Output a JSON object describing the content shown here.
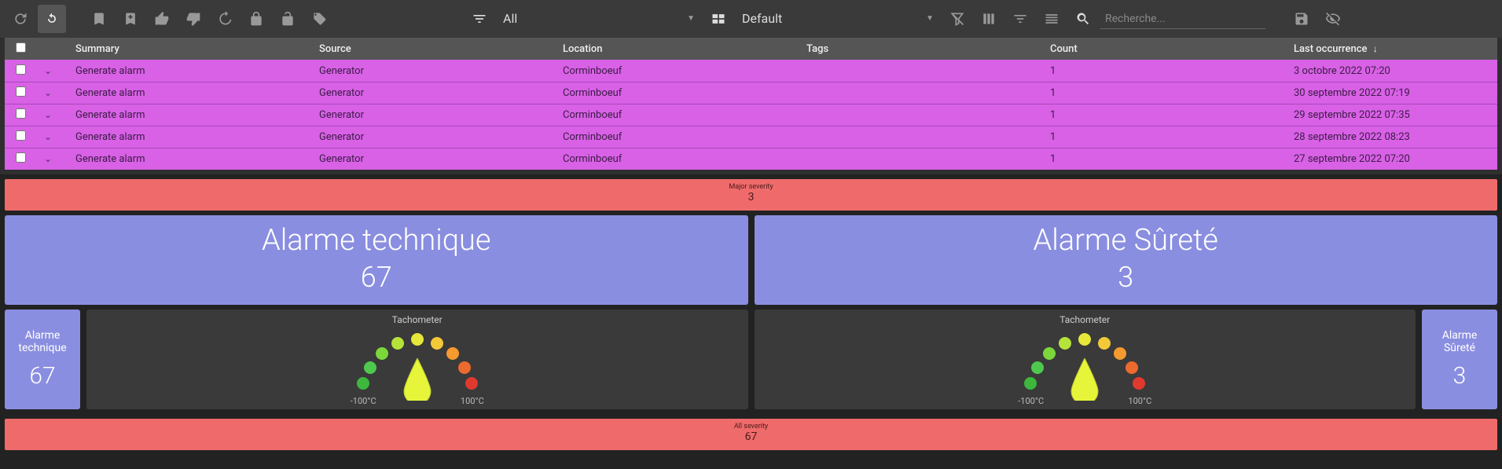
{
  "toolbar": {
    "filter_label": "All",
    "view_label": "Default",
    "search_placeholder": "Recherche..."
  },
  "columns": {
    "summary": "Summary",
    "source": "Source",
    "location": "Location",
    "tags": "Tags",
    "count": "Count",
    "last": "Last occurrence"
  },
  "rows": [
    {
      "summary": "Generate alarm",
      "source": "Generator",
      "location": "Corminboeuf",
      "tags": "",
      "count": "1",
      "last": "3 octobre 2022 07:20"
    },
    {
      "summary": "Generate alarm",
      "source": "Generator",
      "location": "Corminboeuf",
      "tags": "",
      "count": "1",
      "last": "30 septembre 2022 07:19"
    },
    {
      "summary": "Generate alarm",
      "source": "Generator",
      "location": "Corminboeuf",
      "tags": "",
      "count": "1",
      "last": "29 septembre 2022 07:35"
    },
    {
      "summary": "Generate alarm",
      "source": "Generator",
      "location": "Corminboeuf",
      "tags": "",
      "count": "1",
      "last": "28 septembre 2022 08:23"
    },
    {
      "summary": "Generate alarm",
      "source": "Generator",
      "location": "Corminboeuf",
      "tags": "",
      "count": "1",
      "last": "27 septembre 2022 07:20"
    }
  ],
  "severity_top": {
    "label": "Major severity",
    "value": "3"
  },
  "cards": [
    {
      "title": "Alarme technique",
      "value": "67"
    },
    {
      "title": "Alarme Sûreté",
      "value": "3"
    }
  ],
  "mini_left": {
    "title": "Alarme technique",
    "value": "67"
  },
  "mini_right": {
    "title": "Alarme Sûreté",
    "value": "3"
  },
  "tacho": {
    "title": "Tachometer",
    "min_label": "-100°C",
    "max_label": "100°C"
  },
  "severity_bottom": {
    "label": "All severity",
    "value": "67"
  },
  "chart_data": [
    {
      "type": "gauge",
      "title": "Tachometer",
      "min": -100,
      "max": 100,
      "unit": "°C",
      "value": 0
    },
    {
      "type": "gauge",
      "title": "Tachometer",
      "min": -100,
      "max": 100,
      "unit": "°C",
      "value": 0
    }
  ]
}
